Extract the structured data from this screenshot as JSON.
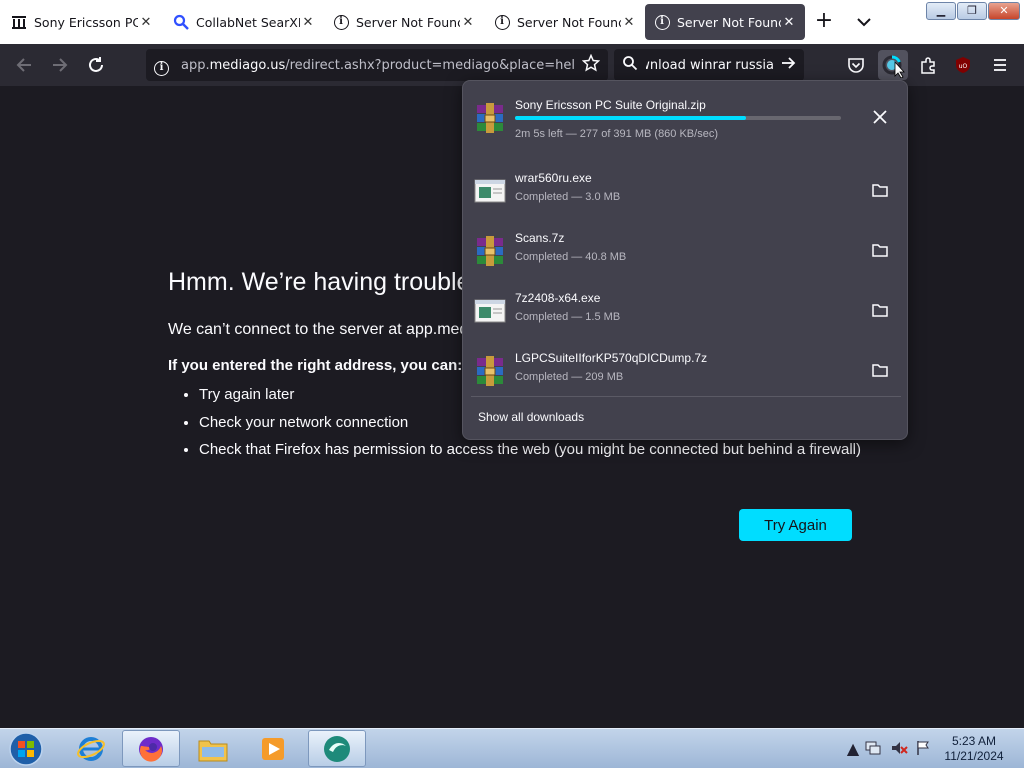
{
  "tabs": [
    {
      "title": "Sony Ericsson PC Suite",
      "icon": "museum-icon",
      "active": false
    },
    {
      "title": "CollabNet SearXNG",
      "icon": "magnifier-icon",
      "active": false
    },
    {
      "title": "Server Not Found",
      "icon": "info-icon",
      "active": false
    },
    {
      "title": "Server Not Found",
      "icon": "info-icon",
      "active": false
    },
    {
      "title": "Server Not Found",
      "icon": "info-icon",
      "active": true
    }
  ],
  "urlbar": {
    "pre": "app.",
    "domain": "mediago.us",
    "post": "/redirect.ashx?product=mediago&place=help&"
  },
  "search": {
    "value": "Download winrar russia"
  },
  "error": {
    "title": "Hmm. We’re having trouble finding that site.",
    "description": "We can’t connect to the server at app.mediago.us.",
    "subtitle": "If you entered the right address, you can:",
    "suggestions": [
      "Try again later",
      "Check your network connection",
      "Check that Firefox has permission to access the web (you might be connected but behind a firewall)"
    ],
    "button": "Try Again"
  },
  "downloads": {
    "items": [
      {
        "name": "Sony Ericsson PC Suite Original.zip",
        "status": "2m 5s left — 277 of 391 MB (860 KB/sec)",
        "progress": 0.71,
        "in_progress": true,
        "icon": "winrar-archive-icon"
      },
      {
        "name": "wrar560ru.exe",
        "status": "Completed — 3.0 MB",
        "in_progress": false,
        "icon": "exe-installer-icon"
      },
      {
        "name": "Scans.7z",
        "status": "Completed — 40.8 MB",
        "in_progress": false,
        "icon": "winrar-archive-icon"
      },
      {
        "name": "7z2408-x64.exe",
        "status": "Completed — 1.5 MB",
        "in_progress": false,
        "icon": "exe-installer-icon"
      },
      {
        "name": "LGPCSuiteIIforKP570qDICDump.7z",
        "status": "Completed — 209 MB",
        "in_progress": false,
        "icon": "winrar-archive-icon"
      }
    ],
    "show_all": "Show all downloads"
  },
  "taskbar": {
    "time": "5:23 AM",
    "date": "11/21/2024"
  },
  "colors": {
    "accent": "#00ddff",
    "page_bg": "#1c1b22",
    "toolbar": "#2b2a33",
    "panel": "#42414d"
  }
}
